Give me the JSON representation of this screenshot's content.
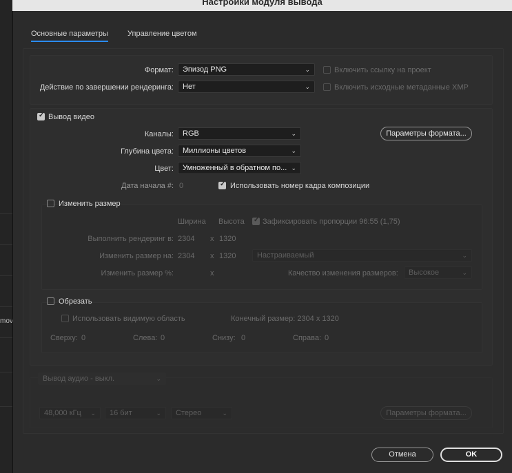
{
  "window": {
    "title": "Настройки модуля вывода"
  },
  "background": {
    "partial_text": "mov"
  },
  "tabs": [
    {
      "label": "Основные параметры",
      "active": true
    },
    {
      "label": "Управление цветом",
      "active": false
    }
  ],
  "general": {
    "format_label": "Формат:",
    "format_value": "Эпизод PNG",
    "post_render_label": "Действие по завершении рендеринга:",
    "post_render_value": "Нет",
    "include_project_link": "Включить ссылку на проект",
    "include_xmp": "Включить исходные метаданные XMP"
  },
  "video": {
    "output_label": "Вывод видео",
    "channels_label": "Каналы:",
    "channels_value": "RGB",
    "depth_label": "Глубина цвета:",
    "depth_value": "Миллионы цветов",
    "color_label": "Цвет:",
    "color_value": "Умноженный в обратном по...",
    "start_label": "Дата начала #:",
    "start_value": "0",
    "use_comp_frame": "Использовать номер кадра композиции",
    "format_options_button": "Параметры формата..."
  },
  "resize": {
    "label": "Изменить размер",
    "width_header": "Ширина",
    "height_header": "Высота",
    "lock_ratio": "Зафиксировать пропорции 96:55 (1,75)",
    "render_at_label": "Выполнить рендеринг в:",
    "render_w": "2304",
    "render_h": "1320",
    "resize_to_label": "Изменить размер на:",
    "resize_w": "2304",
    "resize_h": "1320",
    "preset_value": "Настраиваемый",
    "percent_label": "Изменить размер %:",
    "x": "x",
    "quality_label": "Качество изменения размеров:",
    "quality_value": "Высокое"
  },
  "crop": {
    "label": "Обрезать",
    "use_roi": "Использовать видимую область",
    "final_size": "Конечный размер: 2304 x 1320",
    "top_label": "Сверху:",
    "top_value": "0",
    "left_label": "Слева:",
    "left_value": "0",
    "bottom_label": "Снизу:",
    "bottom_value": "0",
    "right_label": "Справа:",
    "right_value": "0"
  },
  "audio": {
    "output_value": "Вывод аудио - выкл.",
    "rate_value": "48,000 кГц",
    "bits_value": "16 бит",
    "channels_value": "Стерео",
    "format_options_button": "Параметры формата..."
  },
  "footer": {
    "cancel": "Отмена",
    "ok": "OK"
  }
}
